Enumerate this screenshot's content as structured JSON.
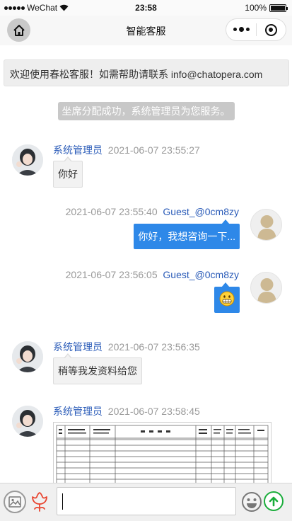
{
  "status_bar": {
    "carrier": "WeChat",
    "time": "23:58",
    "battery": "100%"
  },
  "nav": {
    "title": "智能客服",
    "home_icon": "home-icon",
    "more_icon": "more-dots-icon",
    "close_icon": "close-miniapp-icon"
  },
  "welcome": {
    "text": "欢迎使用春松客服！如需帮助请联系 info@chatopera.com"
  },
  "system_tip": "坐席分配成功，系统管理员为您服务。",
  "messages": [
    {
      "sender": "agent",
      "name": "系统管理员",
      "time": "2021-06-07 23:55:27",
      "text": "你好"
    },
    {
      "sender": "guest",
      "name": "Guest_@0cm8zy",
      "time": "2021-06-07 23:55:40",
      "text": "你好，我想咨询一下..."
    },
    {
      "sender": "guest",
      "name": "Guest_@0cm8zy",
      "time": "2021-06-07 23:56:05",
      "text": "",
      "emoji": "grinning-face-emoji"
    },
    {
      "sender": "agent",
      "name": "系统管理员",
      "time": "2021-06-07 23:56:35",
      "text": "稍等我发资料给您"
    },
    {
      "sender": "agent",
      "name": "系统管理员",
      "time": "2021-06-07 23:58:45",
      "text": "",
      "image": "document-table-image"
    }
  ],
  "toolbar": {
    "image_icon": "image-upload-icon",
    "flower_icon": "flower-icon",
    "input_value": "",
    "emoji_icon": "emoji-face-icon",
    "send_icon": "send-arrow-icon"
  },
  "colors": {
    "agent_name": "#2a5bb8",
    "guest_bubble": "#2e88e8",
    "send_green": "#1aad3b",
    "flower_red": "#e8442f"
  }
}
